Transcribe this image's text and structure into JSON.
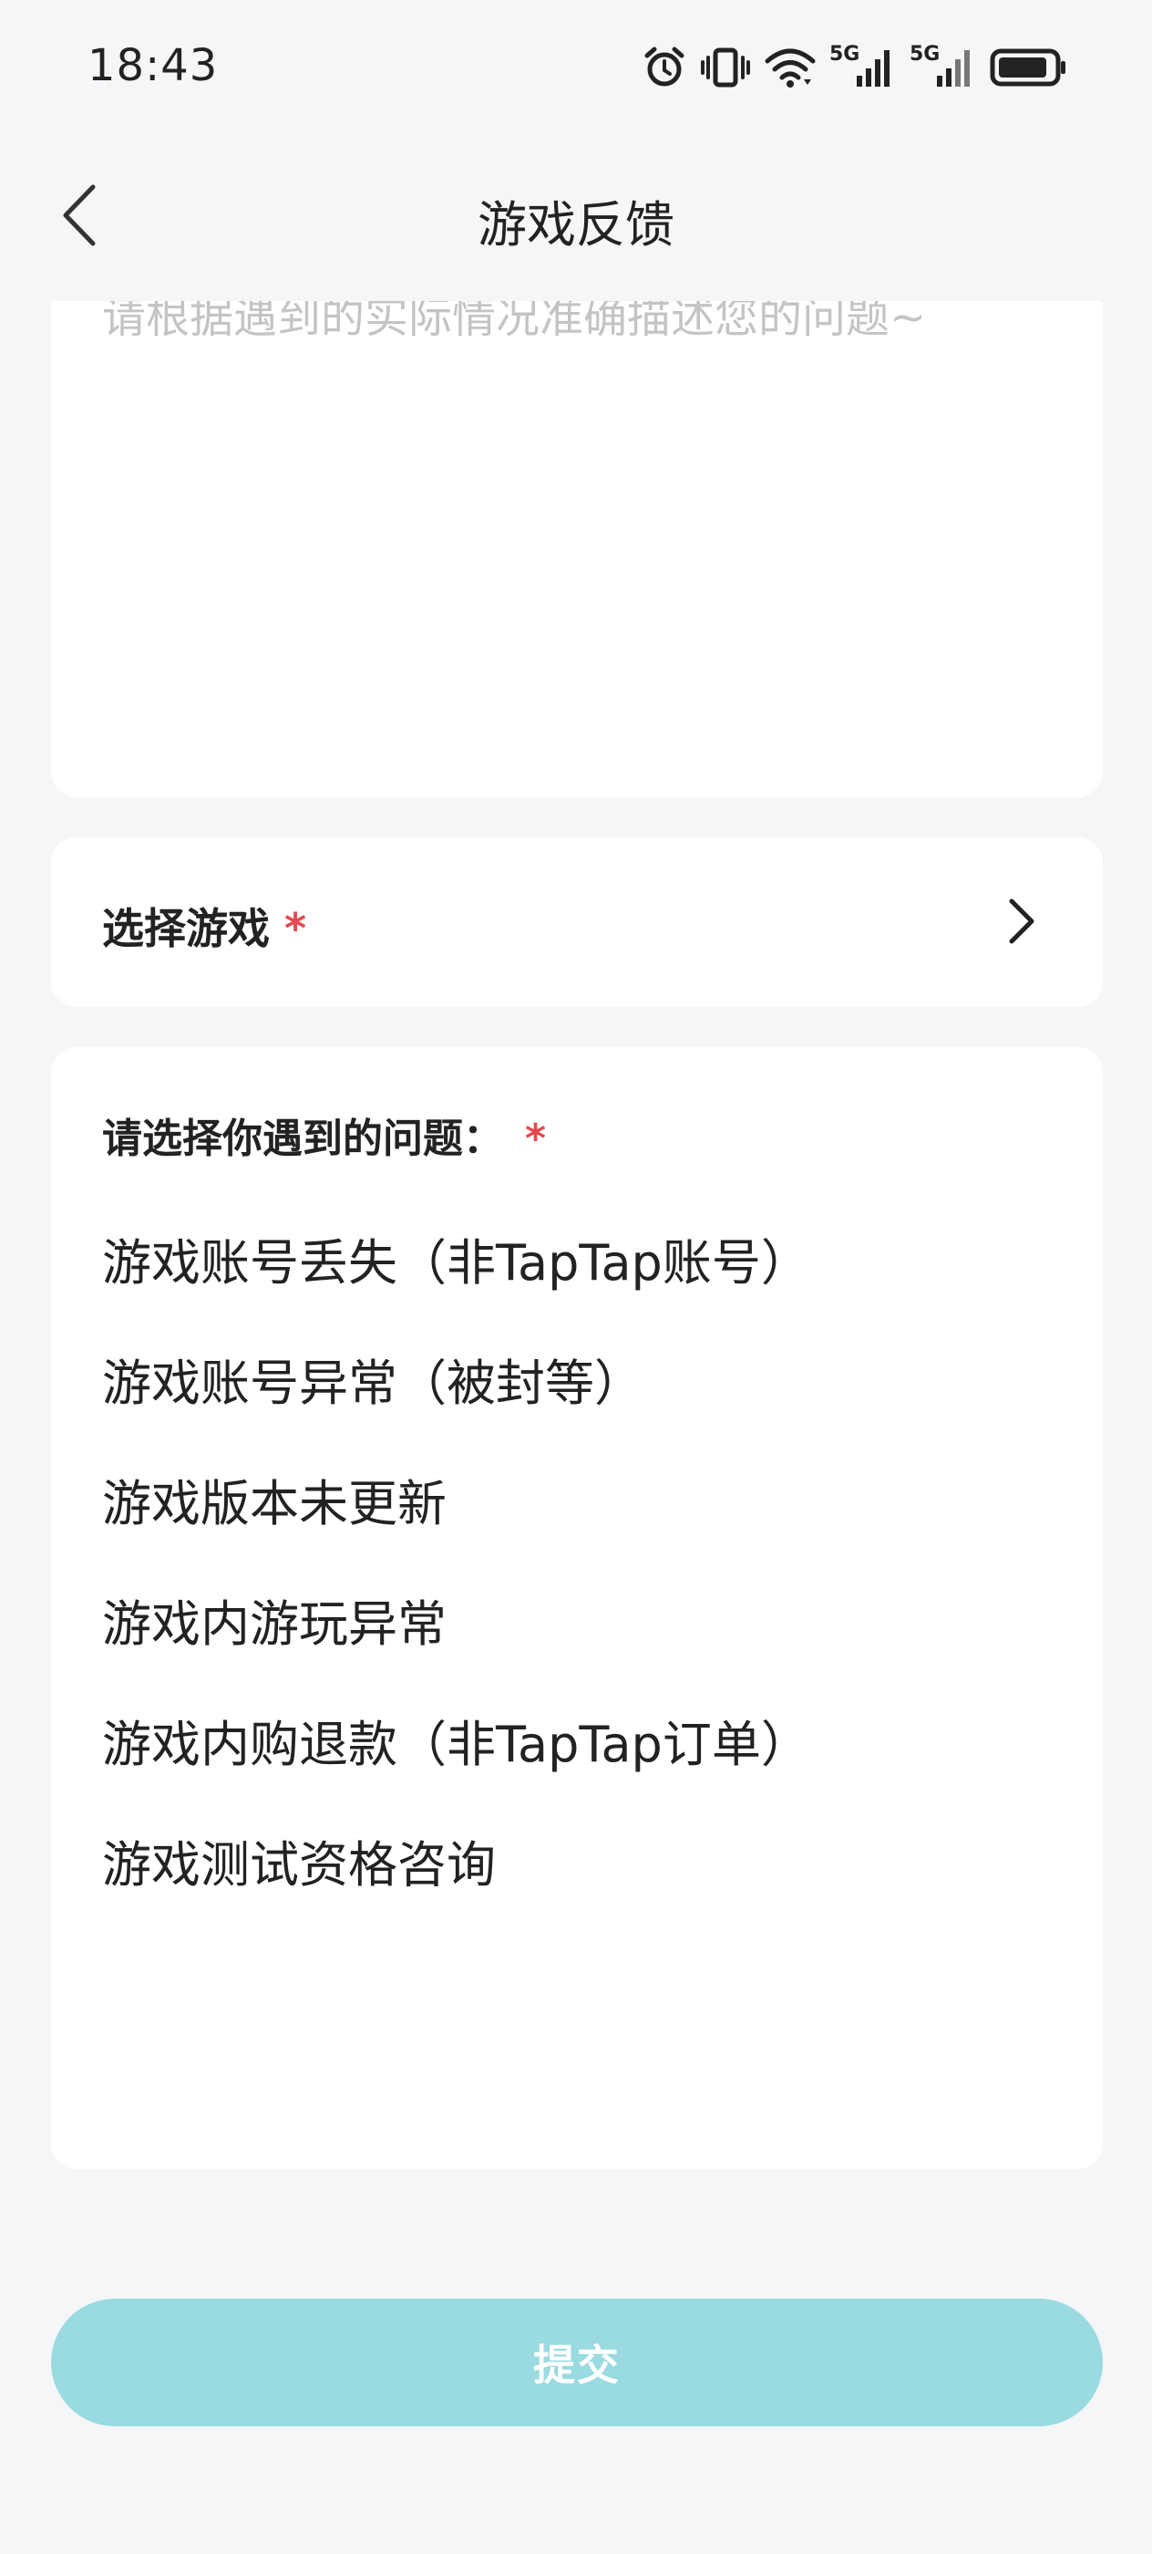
{
  "status_bar": {
    "time": "18:43",
    "icons": [
      "alarm-icon",
      "vibrate-icon",
      "wifi-icon",
      "signal-5g-icon",
      "signal-5g-icon",
      "battery-icon"
    ],
    "network_labels": [
      "5G",
      "5G"
    ]
  },
  "header": {
    "title": "游戏反馈",
    "back_icon": "chevron-left-icon"
  },
  "description": {
    "placeholder": "请根据遇到的实际情况准确描述您的问题~",
    "value": ""
  },
  "select_game": {
    "label": "选择游戏",
    "required_mark": "*",
    "chevron_icon": "chevron-right-icon"
  },
  "problems": {
    "heading": "请选择你遇到的问题：",
    "required_mark": "*",
    "items": [
      {
        "label": "游戏账号丢失（非TapTap账号）"
      },
      {
        "label": "游戏账号异常（被封等）"
      },
      {
        "label": "游戏版本未更新"
      },
      {
        "label": "游戏内游玩异常"
      },
      {
        "label": "游戏内购退款（非TapTap订单）"
      },
      {
        "label": "游戏测试资格咨询"
      }
    ]
  },
  "submit": {
    "label": "提交",
    "enabled": false
  },
  "colors": {
    "background": "#f5f6f8",
    "card": "#ffffff",
    "required": "#e5484d",
    "submit_disabled": "#9adae1",
    "placeholder": "#c4c4c4"
  }
}
